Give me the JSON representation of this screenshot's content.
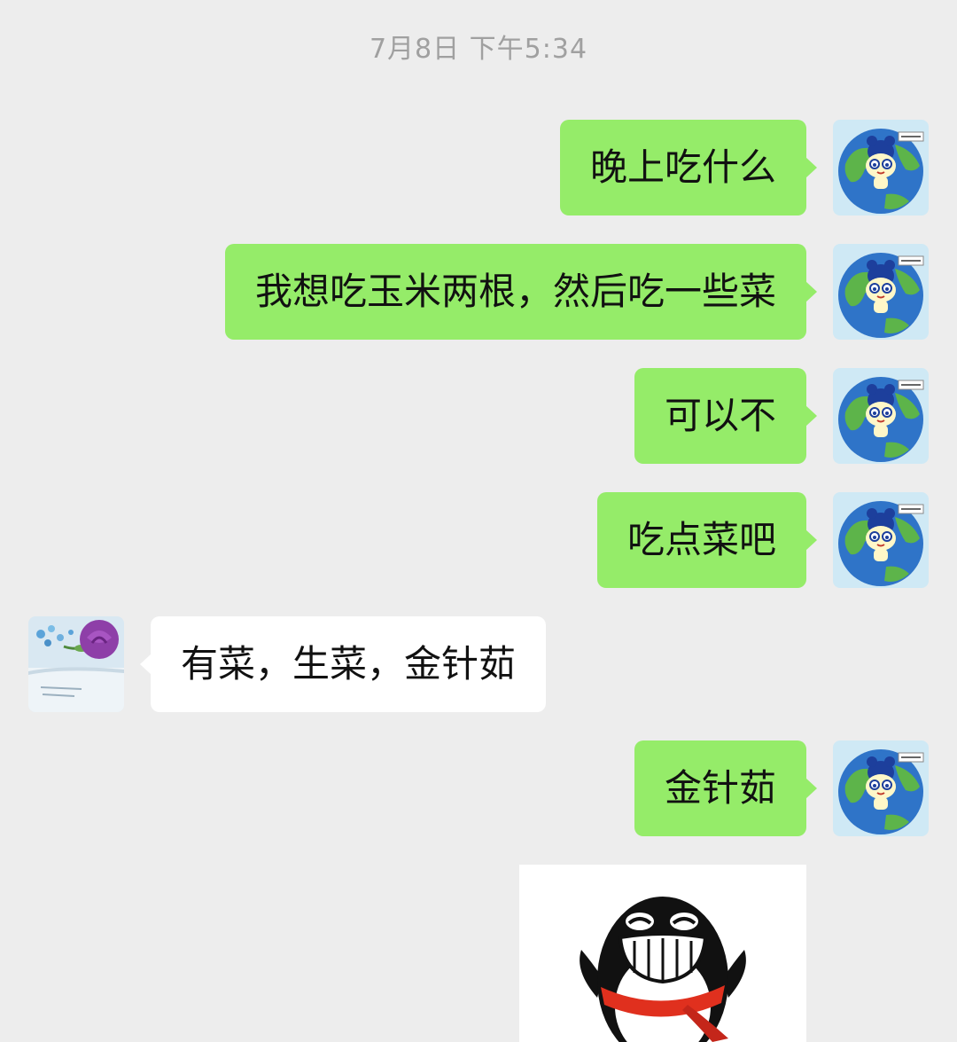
{
  "timestamp": "7月8日 下午5:34",
  "messages": [
    {
      "from": "me",
      "text": "晚上吃什么"
    },
    {
      "from": "me",
      "text": "我想吃玉米两根，然后吃一些菜"
    },
    {
      "from": "me",
      "text": "可以不"
    },
    {
      "from": "me",
      "text": "吃点菜吧"
    },
    {
      "from": "other",
      "text": "有菜，生菜，金针茹"
    },
    {
      "from": "me",
      "text": "金针茹"
    }
  ],
  "sticker": {
    "icon": "qq-penguin-laughing-sticker"
  },
  "colors": {
    "background": "#ededed",
    "my_bubble": "#95ec69",
    "their_bubble": "#ffffff",
    "timestamp": "#a0a0a0"
  }
}
